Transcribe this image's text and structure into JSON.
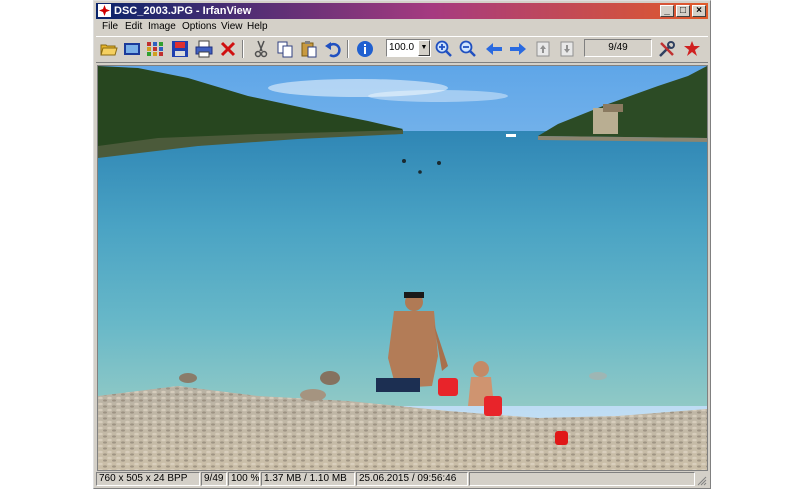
{
  "window": {
    "title": "DSC_2003.JPG - IrfanView"
  },
  "titlebar_buttons": {
    "minimize": "_",
    "maximize": "□",
    "close": "×"
  },
  "menu": [
    "File",
    "Edit",
    "Image",
    "Options",
    "View",
    "Help"
  ],
  "toolbar": {
    "zoom_value": "100.0",
    "file_counter": "9/49",
    "icons": [
      "open-folder-icon",
      "slideshow-icon",
      "thumbnails-icon",
      "save-icon",
      "print-icon",
      "delete-icon",
      "cut-icon",
      "copy-icon",
      "paste-icon",
      "undo-icon",
      "info-icon",
      "zoom-in-icon",
      "zoom-out-icon",
      "previous-icon",
      "next-icon",
      "first-page-icon",
      "last-page-icon",
      "options-icon",
      "exit-icon"
    ]
  },
  "status": {
    "dimensions": "760 x 505 x 24 BPP",
    "index": "9/49",
    "zoom": "100 %",
    "size": "1.37 MB / 1.10 MB",
    "datetime": "25.06.2015 / 09:56:46"
  },
  "colors": {
    "title_start": "#0a246a",
    "title_end": "#e05a2a",
    "face": "#d4d0c8"
  }
}
